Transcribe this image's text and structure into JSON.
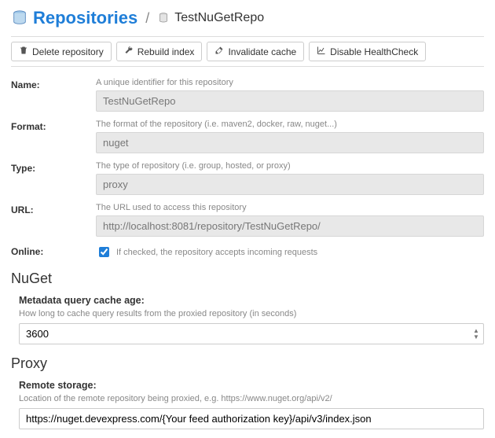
{
  "header": {
    "title": "Repositories",
    "separator": "/",
    "repo_name": "TestNuGetRepo"
  },
  "toolbar": {
    "delete": "Delete repository",
    "rebuild": "Rebuild index",
    "invalidate": "Invalidate cache",
    "disable_hc": "Disable HealthCheck"
  },
  "fields": {
    "name": {
      "label": "Name:",
      "help": "A unique identifier for this repository",
      "value": "TestNuGetRepo"
    },
    "format": {
      "label": "Format:",
      "help": "The format of the repository (i.e. maven2, docker, raw, nuget...)",
      "value": "nuget"
    },
    "type": {
      "label": "Type:",
      "help": "The type of repository (i.e. group, hosted, or proxy)",
      "value": "proxy"
    },
    "url": {
      "label": "URL:",
      "help": "The URL used to access this repository",
      "value": "http://localhost:8081/repository/TestNuGetRepo/"
    },
    "online": {
      "label": "Online:",
      "help": "If checked, the repository accepts incoming requests",
      "checked": true
    }
  },
  "nuget": {
    "section": "NuGet",
    "cache_label": "Metadata query cache age:",
    "cache_help": "How long to cache query results from the proxied repository (in seconds)",
    "cache_value": "3600"
  },
  "proxy": {
    "section": "Proxy",
    "remote_label": "Remote storage:",
    "remote_help": "Location of the remote repository being proxied, e.g. https://www.nuget.org/api/v2/",
    "remote_value": "https://nuget.devexpress.com/{Your feed authorization key}/api/v3/index.json"
  }
}
